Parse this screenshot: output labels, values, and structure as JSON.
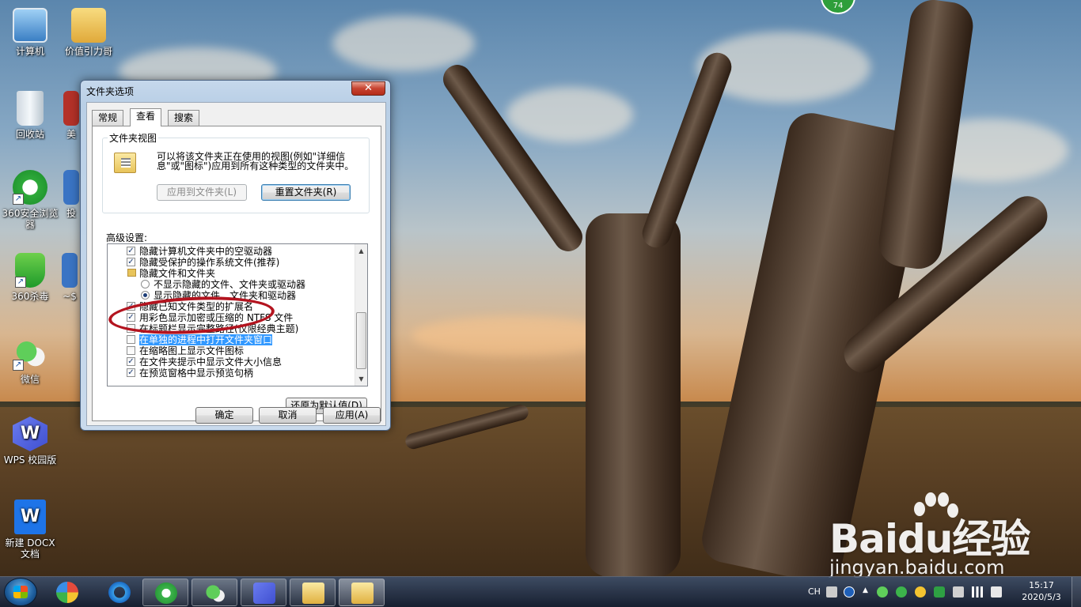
{
  "desktop": {
    "icons": [
      {
        "label": "计算机",
        "icon": "computer-icon"
      },
      {
        "label": "价值引力哥",
        "icon": "folder-icon"
      },
      {
        "label": "回收站",
        "icon": "recycle-bin-icon"
      },
      {
        "label": "美",
        "icon": "app-icon"
      },
      {
        "label": "360安全浏览器",
        "icon": "360-browser-icon"
      },
      {
        "label": "投",
        "icon": "app-icon"
      },
      {
        "label": "360杀毒",
        "icon": "360-antivirus-icon"
      },
      {
        "label": "~$",
        "icon": "doc-icon"
      },
      {
        "label": "微信",
        "icon": "wechat-icon"
      },
      {
        "label": "WPS 校园版",
        "icon": "wps-icon"
      },
      {
        "label": "新建 DOCX 文档",
        "icon": "docx-icon"
      }
    ],
    "badge": "74"
  },
  "dialog": {
    "title": "文件夹选项",
    "close": "✕",
    "tabs": [
      "常规",
      "查看",
      "搜索"
    ],
    "active_tab": "查看",
    "folder_views": {
      "legend": "文件夹视图",
      "description": "可以将该文件夹正在使用的视图(例如\"详细信息\"或\"图标\")应用到所有这种类型的文件夹中。",
      "apply_button": "应用到文件夹(L)",
      "reset_button": "重置文件夹(R)"
    },
    "advanced_label": "高级设置:",
    "settings": [
      {
        "type": "checkbox",
        "checked": true,
        "label": "隐藏计算机文件夹中的空驱动器"
      },
      {
        "type": "checkbox",
        "checked": true,
        "label": "隐藏受保护的操作系统文件(推荐)"
      },
      {
        "type": "folder",
        "label": "隐藏文件和文件夹"
      },
      {
        "type": "radio",
        "checked": false,
        "label": "不显示隐藏的文件、文件夹或驱动器"
      },
      {
        "type": "radio",
        "checked": true,
        "label": "显示隐藏的文件、文件夹和驱动器"
      },
      {
        "type": "checkbox",
        "checked": true,
        "label": "隐藏已知文件类型的扩展名"
      },
      {
        "type": "checkbox",
        "checked": true,
        "label": "用彩色显示加密或压缩的 NTFS 文件"
      },
      {
        "type": "checkbox",
        "checked": false,
        "label": "在标题栏显示完整路径(仅限经典主题)"
      },
      {
        "type": "checkbox",
        "checked": false,
        "label": "在单独的进程中打开文件夹窗口",
        "selected": true
      },
      {
        "type": "checkbox",
        "checked": false,
        "label": "在缩略图上显示文件图标"
      },
      {
        "type": "checkbox",
        "checked": true,
        "label": "在文件夹提示中显示文件大小信息"
      },
      {
        "type": "checkbox",
        "checked": true,
        "label": "在预览窗格中显示预览句柄"
      }
    ],
    "restore_button": "还原为默认值(D)",
    "ok_button": "确定",
    "cancel_button": "取消",
    "apply_button": "应用(A)"
  },
  "taskbar": {
    "language": "CH",
    "time": "15:17",
    "date": "2020/5/3"
  },
  "watermark": {
    "main": "Baidu经验",
    "url": "jingyan.baidu.com"
  }
}
